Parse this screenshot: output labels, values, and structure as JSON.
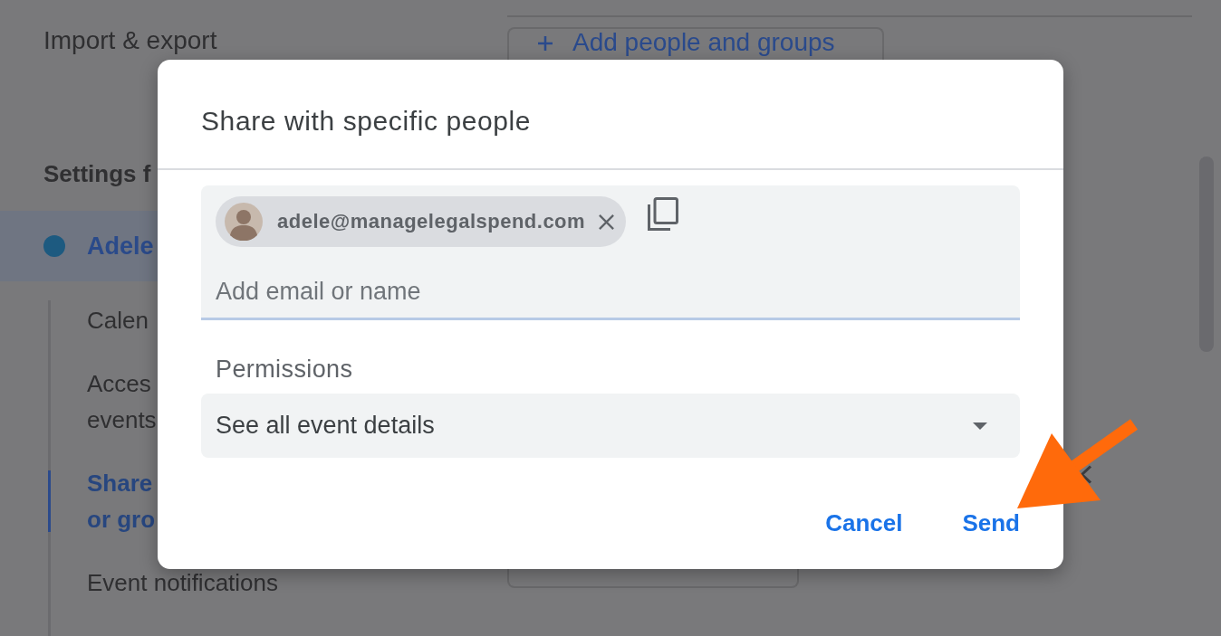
{
  "background_page": {
    "sidebar": {
      "items": [
        {
          "kind": "link",
          "label": "Import & export",
          "selected": false
        },
        {
          "kind": "heading",
          "label": "Settings f"
        },
        {
          "kind": "calendar",
          "label": "Adele",
          "color": "#1d5a80",
          "selected": true,
          "children": [
            {
              "lines": [
                "Calen"
              ],
              "selected": false
            },
            {
              "lines": [
                "Acces",
                "events"
              ],
              "selected": false
            },
            {
              "lines": [
                "Share",
                "or gro"
              ],
              "selected": true
            },
            {
              "lines": [
                "Event notifications"
              ],
              "selected": false
            }
          ]
        }
      ]
    },
    "main": {
      "add_button": {
        "label": "Add people and groups"
      }
    }
  },
  "dialog": {
    "title": "Share with specific people",
    "recipients": [
      {
        "email": "adele@managelegalspend.com"
      }
    ],
    "input": {
      "placeholder": "Add email or name"
    },
    "permissions": {
      "label": "Permissions",
      "value": "See all event details"
    },
    "buttons": [
      {
        "label": "Cancel"
      },
      {
        "label": "Send"
      }
    ]
  }
}
